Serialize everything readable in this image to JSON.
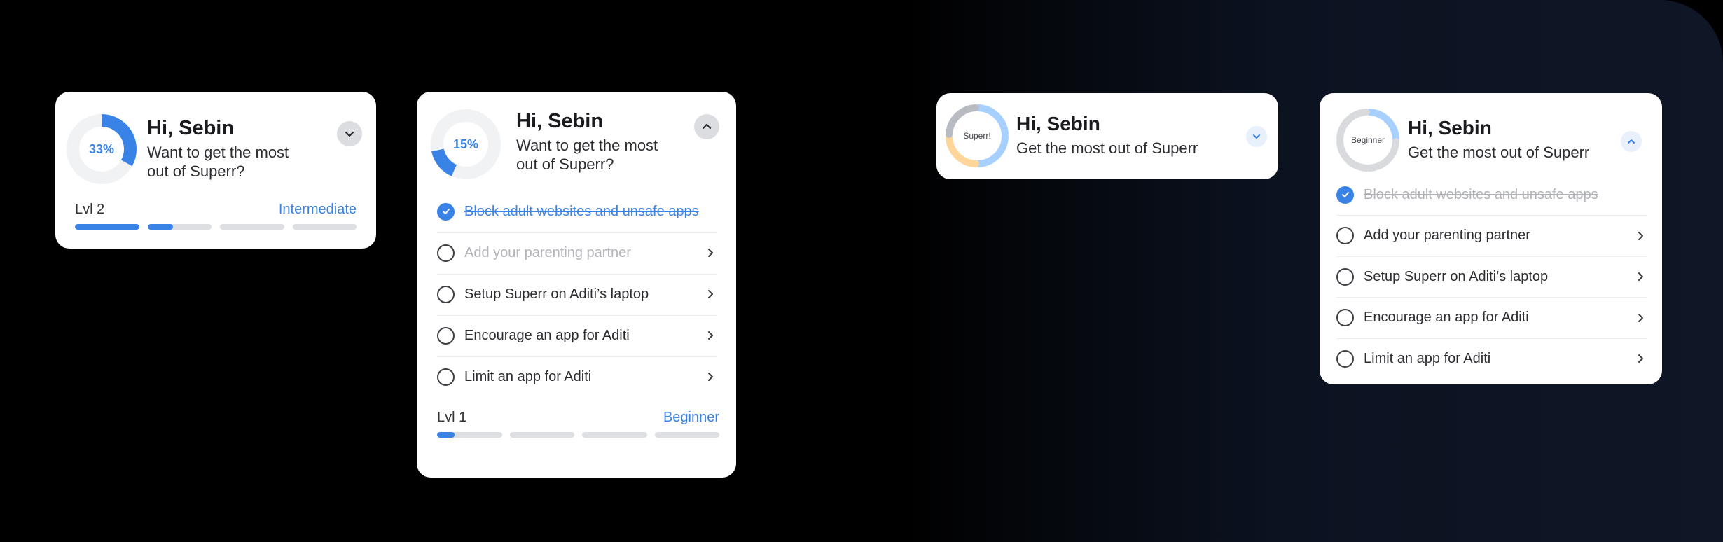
{
  "colors": {
    "accent": "#3a83e6",
    "track": "#f1f2f4",
    "bar_empty": "#dedfe2",
    "muted_text": "#b3b5ba"
  },
  "card1": {
    "progress_label": "33%",
    "progress": 0.33,
    "greeting": "Hi, Sebin",
    "subtitle_line1": "Want to get the most",
    "subtitle_line2": "out of Superr?",
    "toggle_icon": "chevron-down-icon",
    "level_label": "Lvl 2",
    "level_tier": "Intermediate",
    "bars_fill": [
      1,
      0.4,
      0,
      0
    ]
  },
  "card2": {
    "progress_label": "15%",
    "progress": 0.15,
    "greeting": "Hi, Sebin",
    "subtitle_line1": "Want to get the most",
    "subtitle_line2": "out of Superr?",
    "toggle_icon": "chevron-up-icon",
    "tasks": [
      {
        "label": "Block adult websites and unsafe apps",
        "done": true
      },
      {
        "label": "Add your parenting partner",
        "done": false
      },
      {
        "label": "Setup Superr on Aditi’s laptop",
        "done": false
      },
      {
        "label": "Encourage an app for Aditi",
        "done": false
      },
      {
        "label": "Limit an app for Aditi",
        "done": false
      }
    ],
    "level_label": "Lvl 1",
    "level_tier": "Beginner",
    "bars_fill": [
      0.27,
      0,
      0,
      0
    ]
  },
  "card3": {
    "ring_label": "Superr!",
    "greeting": "Hi, Sebin",
    "subtitle": "Get the most out of Superr",
    "toggle_icon": "chevron-down-icon",
    "ring_colors": [
      "#a8d0ff",
      "#a8d0ff",
      "#ffd59a",
      "#b8bcc2"
    ]
  },
  "card4": {
    "ring_label": "Beginner",
    "greeting": "Hi, Sebin",
    "subtitle": "Get the most out of Superr",
    "toggle_icon": "chevron-up-icon",
    "ring_colors": [
      "#a8d0ff",
      "#d8dadd",
      "#d8dadd",
      "#d8dadd"
    ],
    "tasks": [
      {
        "label": "Block adult websites and unsafe apps",
        "done": true
      },
      {
        "label": "Add your parenting partner",
        "done": false
      },
      {
        "label": "Setup Superr on Aditi’s laptop",
        "done": false
      },
      {
        "label": "Encourage an app for Aditi",
        "done": false
      },
      {
        "label": "Limit an app for Aditi",
        "done": false
      }
    ]
  }
}
